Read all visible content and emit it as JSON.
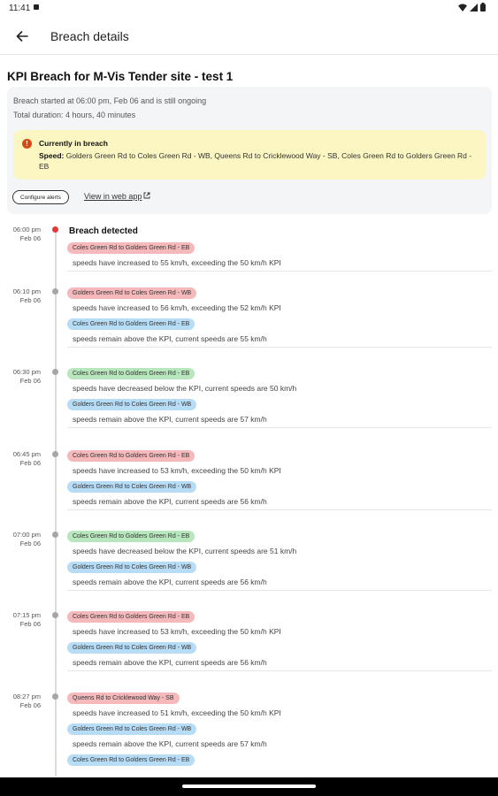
{
  "status_bar": {
    "time": "11:41"
  },
  "app_bar": {
    "title": "Breach details"
  },
  "page": {
    "title": "KPI Breach for M-Vis Tender site - test 1"
  },
  "summary": {
    "started": "Breach started at 06:00 pm, Feb 06 and is still ongoing",
    "duration": "Total duration: 4 hours, 40 minutes",
    "alert_heading": "Currently in breach",
    "alert_label": "Speed:",
    "alert_text": " Golders Green Rd to Coles Green Rd - WB, Queens Rd to Cricklewood Way - SB, Coles Green Rd to Golders Green Rd - EB",
    "configure_label": "Configure alerts",
    "web_link": "View in web app"
  },
  "events": [
    {
      "time": "06:00 pm",
      "date": "Feb 06",
      "heading": "Breach detected",
      "items": [
        {
          "chip": "Coles Green Rd to Golders Green Rd - EB",
          "color": "red",
          "text": "speeds have increased to 55 km/h, exceeding the 50 km/h KPI"
        }
      ]
    },
    {
      "time": "06:10 pm",
      "date": "Feb 06",
      "items": [
        {
          "chip": "Golders Green Rd to Coles Green Rd - WB",
          "color": "red",
          "text": "speeds have increased to 56 km/h, exceeding the 52 km/h KPI"
        },
        {
          "chip": "Coles Green Rd to Golders Green Rd - EB",
          "color": "blue",
          "text": "speeds remain above the KPI, current speeds are 55 km/h"
        }
      ]
    },
    {
      "time": "06:30 pm",
      "date": "Feb 06",
      "items": [
        {
          "chip": "Coles Green Rd to Golders Green Rd - EB",
          "color": "green",
          "text": "speeds have decreased below the KPI, current speeds are 50 km/h"
        },
        {
          "chip": "Golders Green Rd to Coles Green Rd - WB",
          "color": "blue",
          "text": "speeds remain above the KPI, current speeds are 57 km/h"
        }
      ]
    },
    {
      "time": "06:45 pm",
      "date": "Feb 06",
      "items": [
        {
          "chip": "Coles Green Rd to Golders Green Rd - EB",
          "color": "red",
          "text": "speeds have increased to 53 km/h, exceeding the 50 km/h KPI"
        },
        {
          "chip": "Golders Green Rd to Coles Green Rd - WB",
          "color": "blue",
          "text": "speeds remain above the KPI, current speeds are 56 km/h"
        }
      ]
    },
    {
      "time": "07:00 pm",
      "date": "Feb 06",
      "items": [
        {
          "chip": "Coles Green Rd to Golders Green Rd - EB",
          "color": "green",
          "text": "speeds have decreased below the KPI, current speeds are 51 km/h"
        },
        {
          "chip": "Golders Green Rd to Coles Green Rd - WB",
          "color": "blue",
          "text": "speeds remain above the KPI, current speeds are 56 km/h"
        }
      ]
    },
    {
      "time": "07:15 pm",
      "date": "Feb 06",
      "items": [
        {
          "chip": "Coles Green Rd to Golders Green Rd - EB",
          "color": "red",
          "text": "speeds have increased to 53 km/h, exceeding the 50 km/h KPI"
        },
        {
          "chip": "Golders Green Rd to Coles Green Rd - WB",
          "color": "blue",
          "text": "speeds remain above the KPI, current speeds are 56 km/h"
        }
      ]
    },
    {
      "time": "08:27 pm",
      "date": "Feb 06",
      "items": [
        {
          "chip": "Queens Rd to Cricklewood Way - SB",
          "color": "red",
          "text": "speeds have increased to 51 km/h, exceeding the 50 km/h KPI"
        },
        {
          "chip": "Golders Green Rd to Coles Green Rd - WB",
          "color": "blue",
          "text": "speeds remain above the KPI, current speeds are 57 km/h"
        },
        {
          "chip": "Coles Green Rd to Golders Green Rd - EB",
          "color": "blue",
          "text": ""
        }
      ]
    }
  ]
}
